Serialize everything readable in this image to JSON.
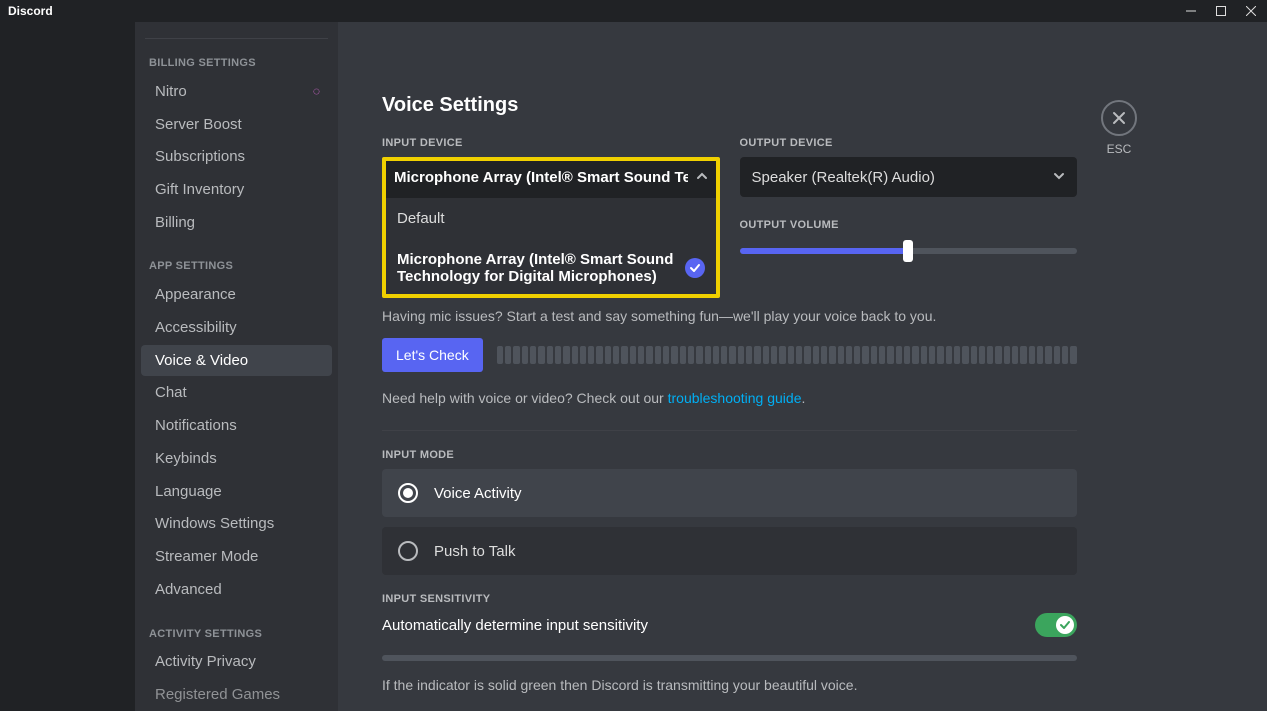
{
  "os": {
    "app_name": "Discord"
  },
  "esc_label": "ESC",
  "sidebar": {
    "billing_header": "BILLING SETTINGS",
    "billing_items": [
      "Nitro",
      "Server Boost",
      "Subscriptions",
      "Gift Inventory",
      "Billing"
    ],
    "app_header": "APP SETTINGS",
    "app_items": [
      "Appearance",
      "Accessibility",
      "Voice & Video",
      "Chat",
      "Notifications",
      "Keybinds",
      "Language",
      "Windows Settings",
      "Streamer Mode",
      "Advanced"
    ],
    "activity_header": "ACTIVITY SETTINGS",
    "activity_items": [
      "Activity Privacy",
      "Registered Games"
    ],
    "selected": "Voice & Video"
  },
  "page": {
    "title": "Voice Settings",
    "input_device_label": "INPUT DEVICE",
    "output_device_label": "OUTPUT DEVICE",
    "input_device_selected": "Microphone Array (Intel® Smart Sound Te",
    "output_device_selected": "Speaker (Realtek(R) Audio)",
    "input_options": {
      "0": {
        "label": "Default",
        "selected": false
      },
      "1": {
        "label": "Microphone Array (Intel® Smart Sound Technology for Digital Microphones)",
        "selected": true
      }
    },
    "output_volume_label": "OUTPUT VOLUME",
    "output_volume_percent": 50,
    "mic_test_hint": "Having mic issues? Start a test and say something fun—we'll play your voice back to you.",
    "lets_check": "Let's Check",
    "help_prefix": "Need help with voice or video? Check out our ",
    "help_link": "troubleshooting guide",
    "help_suffix": ".",
    "input_mode_label": "INPUT MODE",
    "mode_voice_activity": "Voice Activity",
    "mode_push_to_talk": "Push to Talk",
    "input_sensitivity_label": "INPUT SENSITIVITY",
    "auto_sensitivity_label": "Automatically determine input sensitivity",
    "sensitivity_desc": "If the indicator is solid green then Discord is transmitting your beautiful voice."
  }
}
